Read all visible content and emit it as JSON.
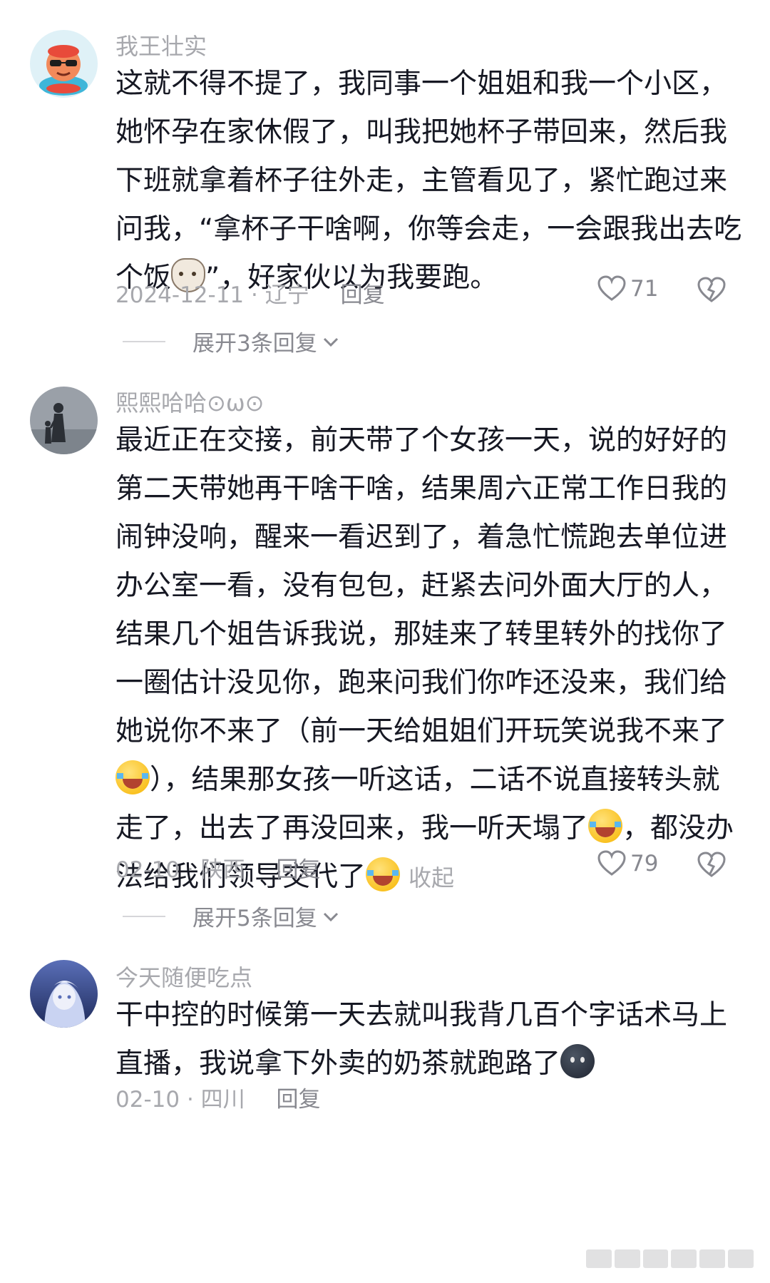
{
  "comments": [
    {
      "username": "我王壮实",
      "lines": [
        "这就不得不提了，我同事一个姐姐和我一个小区，",
        "她怀孕在家休假了，叫我把她杯子带回来，然后我",
        "下班就拿着杯子往外走，主管看见了，紧忙跑过来",
        "问我，“拿杯子干啥啊，你等会走，一会跟我出去吃"
      ],
      "last_line_start": "个饭",
      "last_line_end": "”，好家伙以为我要跑。",
      "date": "2024-12-11",
      "location": "辽宁",
      "reply_label": "回复",
      "likes": "71",
      "expand_label": "展开3条回复",
      "emoji": "cat-emoji"
    },
    {
      "username": "熙熙哈哈⊙ω⊙",
      "lines": [
        "最近正在交接，前天带了个女孩一天，说的好好的",
        "第二天带她再干啥干啥，结果周六正常工作日我的",
        "闹钟没响，醒来一看迟到了，着急忙慌跑去单位进",
        "办公室一看，没有包包，赶紧去问外面大厅的人，",
        "结果几个姐告诉我说，那娃来了转里转外的找你了",
        "一圈估计没见你，跑来问我们你咋还没来，我们给",
        "她说你不来了（前一天给姐姐们开玩笑说我不来了"
      ],
      "line8": "），结果那女孩一听这话，二话不说直接转头就",
      "line9_a": "走了，出去了再没回来，我一听天塌了",
      "line9_b": "，都没办",
      "line10": "法给我们领导交代了",
      "collapse_label": "收起",
      "date": "02-10",
      "location": "陕西",
      "reply_label": "回复",
      "likes": "79",
      "expand_label": "展开5条回复",
      "emoji": "laugh-cry-emoji"
    },
    {
      "username": "今天随便吃点",
      "lines": [
        "干中控的时候第一天去就叫我背几百个字话术马上"
      ],
      "line2": "直播，我说拿下外卖的奶茶就跑路了",
      "date": "02-10",
      "location": "四川",
      "reply_label": "回复",
      "emoji": "dark-face-emoji"
    }
  ],
  "colors": {
    "text": "#161823",
    "meta": "#a7a8ad",
    "background": "#ffffff"
  }
}
